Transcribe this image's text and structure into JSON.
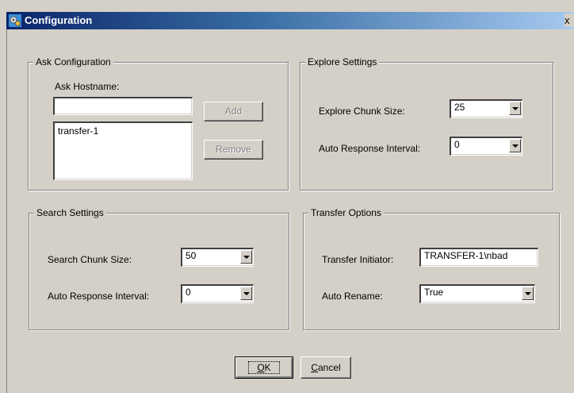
{
  "window": {
    "title": "Configuration",
    "close_glyph": "x"
  },
  "ask": {
    "legend": "Ask Configuration",
    "hostname_label": "Ask Hostname:",
    "hostname_value": "",
    "add_label": "Add",
    "remove_label": "Remove",
    "hosts": [
      "transfer-1"
    ]
  },
  "explore": {
    "legend": "Explore Settings",
    "chunk_label": "Explore Chunk Size:",
    "chunk_value": "25",
    "interval_label": "Auto Response Interval:",
    "interval_value": "0"
  },
  "search": {
    "legend": "Search Settings",
    "chunk_label": "Search Chunk Size:",
    "chunk_value": "50",
    "interval_label": "Auto Response Interval:",
    "interval_value": "0"
  },
  "transfer": {
    "legend": "Transfer Options",
    "initiator_label": "Transfer Initiator:",
    "initiator_value": "TRANSFER-1\\nbad",
    "rename_label": "Auto Rename:",
    "rename_value": "True"
  },
  "buttons": {
    "ok_mnemonic": "O",
    "ok_rest": "K",
    "cancel_mnemonic": "C",
    "cancel_rest": "ancel"
  },
  "colors": {
    "title_start": "#0a246a",
    "title_end": "#a6caf0",
    "face": "#d4d0c8"
  }
}
